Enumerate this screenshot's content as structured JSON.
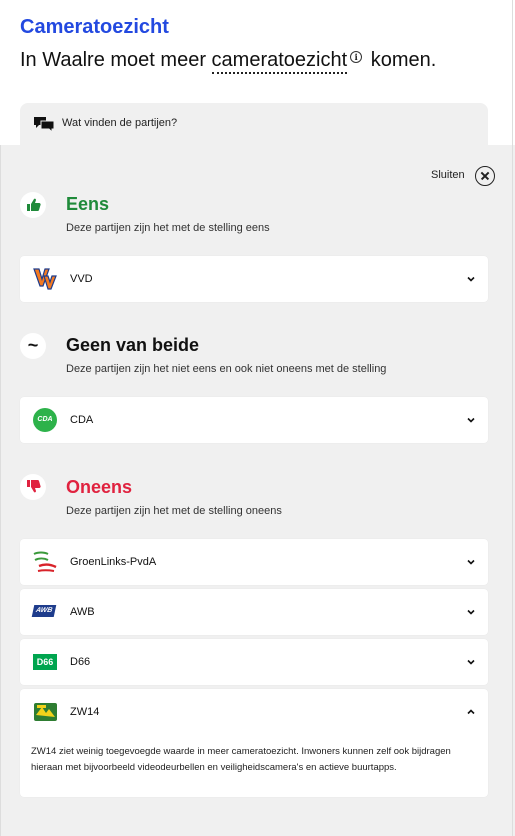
{
  "header": {
    "theme_title": "Cameratoezicht",
    "statement_before": "In Waalre moet meer ",
    "statement_term": "cameratoezicht",
    "info_glyph": "i",
    "statement_after": " komen."
  },
  "tab": {
    "label": "Wat vinden de partijen?",
    "icon": "chat-bubbles-icon"
  },
  "close": {
    "label": "Sluiten",
    "icon": "close-circle-icon"
  },
  "groups": {
    "agree": {
      "title": "Eens",
      "desc": "Deze partijen zijn het met de stelling eens",
      "color": "#1f8a3a",
      "icon": "thumbs-up-icon",
      "parties": [
        {
          "name": "VVD",
          "logo": "vvd-logo"
        }
      ]
    },
    "neutral": {
      "title": "Geen van beide",
      "desc": "Deze partijen zijn het niet eens en ook niet oneens met de stelling",
      "color": "#111111",
      "icon": "tilde-icon",
      "glyph": "~",
      "parties": [
        {
          "name": "CDA",
          "logo": "cda-logo",
          "logo_text": "CDA"
        }
      ]
    },
    "disagree": {
      "title": "Oneens",
      "desc": "Deze partijen zijn het met de stelling oneens",
      "color": "#e0223f",
      "icon": "thumbs-down-icon",
      "parties": [
        {
          "name": "GroenLinks-PvdA",
          "logo": "groenlinks-pvda-logo"
        },
        {
          "name": "AWB",
          "logo": "awb-logo",
          "logo_text": "AWB"
        },
        {
          "name": "D66",
          "logo": "d66-logo",
          "logo_text": "D66"
        },
        {
          "name": "ZW14",
          "logo": "zw14-logo",
          "expanded": true,
          "explanation": "ZW14 ziet weinig toegevoegde waarde in meer cameratoezicht. Inwoners kunnen zelf ook bijdragen hieraan met bijvoorbeeld videodeurbellen en veiligheidscamera's en actieve buurtapps."
        }
      ]
    }
  }
}
